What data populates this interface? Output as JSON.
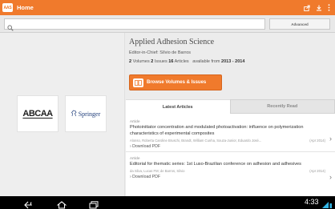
{
  "app": {
    "icon_text": "AAS",
    "title": "Home"
  },
  "icons": [
    "export-icon",
    "download-icon",
    "overflow-menu-icon",
    "search-icon",
    "back-icon",
    "home-icon",
    "recents-icon",
    "signal-icon"
  ],
  "colors": {
    "accent": "#f07a2c",
    "springer_blue": "#1f3d7a",
    "background": "#ececec"
  },
  "search": {
    "placeholder": "",
    "advanced_label": "Advanced"
  },
  "logos": {
    "society": "ABCAA",
    "publisher": "Springer"
  },
  "journal": {
    "title": "Applied Adhesion Science",
    "editor": "Editor-in-Chief: Sílvio de Barros",
    "volumes_count": "2",
    "volumes_label": "Volumes",
    "issues_count": "2",
    "issues_label": "Issues",
    "articles_count": "16",
    "articles_label": "Articles",
    "available_text": "available from",
    "years": "2013 - 2014",
    "browse_label": "Browse Volumes & Issues"
  },
  "tabs": [
    {
      "label": "Latest Articles",
      "selected": true
    },
    {
      "label": "Recently Read",
      "selected": false
    }
  ],
  "articles": [
    {
      "type": "Article",
      "title": "Photoinitiator concentration and modulated photoactivation: influence on polymerization characteristics of experimental composites",
      "authors": "Alonso, Roberta Caroline Bruschi, Brandt, William Cunha, Souza-Junior, Eduardo José...",
      "date": "(Apr 2014)",
      "pdf": "› Download PDF"
    },
    {
      "type": "Article",
      "title": "Editorial for thematic series: 1st Luso-Brazilian conference on adhesion and adhesives",
      "authors": "da Silva, Lucas FM; de Barros, Silvio",
      "date": "(Apr 2014)",
      "pdf": "› Download PDF"
    }
  ],
  "status": {
    "time": "4:33"
  }
}
